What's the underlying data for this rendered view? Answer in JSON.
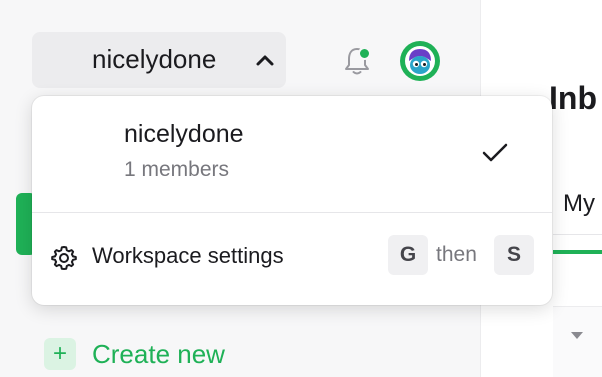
{
  "workspace_switcher": {
    "name": "nicelydone",
    "chevron_icon": "chevron-up-icon"
  },
  "header": {
    "bell_icon": "bell-icon",
    "notification_dot_color": "#1fb157",
    "avatar_icon": "avatar-icon"
  },
  "dropdown": {
    "workspace": {
      "name": "nicelydone",
      "members": "1 members",
      "selected_icon": "checkmark-icon"
    },
    "settings": {
      "label": "Workspace settings",
      "icon": "gear-icon",
      "shortcut_key_1": "G",
      "shortcut_joiner": "then",
      "shortcut_key_2": "S"
    }
  },
  "sidebar": {
    "create_new_label": "Create new",
    "create_new_icon": "+"
  },
  "main": {
    "title_partial": "Inb",
    "tab_partial": "My"
  },
  "colors": {
    "accent": "#1fb157",
    "accent_light": "#dbf3e3"
  }
}
